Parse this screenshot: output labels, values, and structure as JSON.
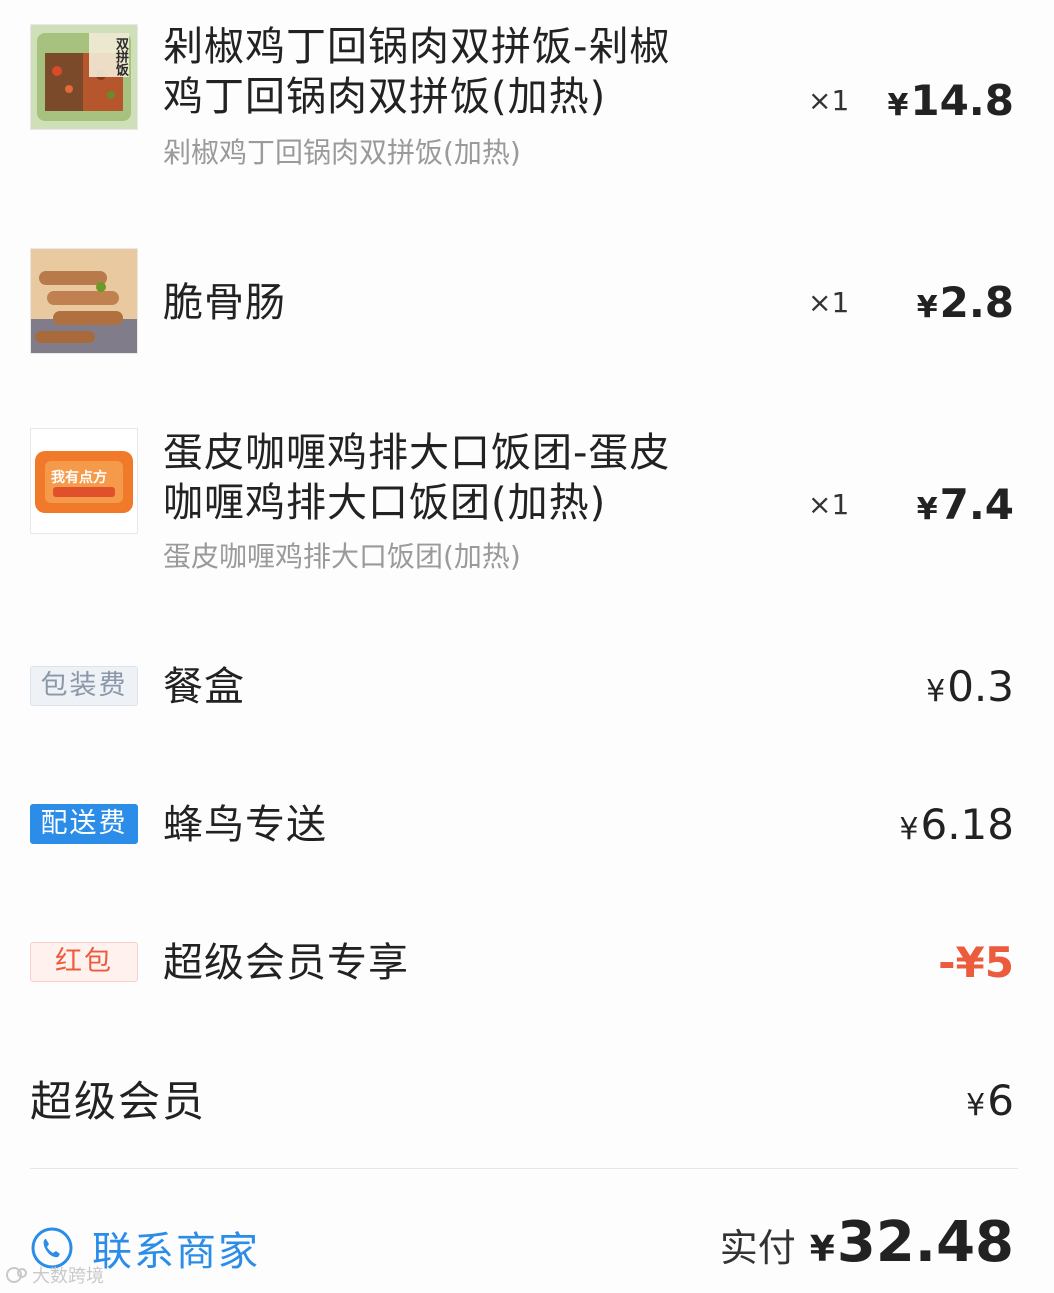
{
  "items": [
    {
      "name": "剁椒鸡丁回锅肉双拼饭-剁椒鸡丁回锅肉双拼饭(加热)",
      "spec": "剁椒鸡丁回锅肉双拼饭(加热)",
      "qty": "×1",
      "price": "14.8",
      "thumb_text": "双拼饭",
      "icon": "rice-box-thumbnail"
    },
    {
      "name": "脆骨肠",
      "spec": "",
      "qty": "×1",
      "price": "2.8",
      "icon": "sausage-thumbnail"
    },
    {
      "name": "蛋皮咖喱鸡排大口饭团-蛋皮咖喱鸡排大口饭团(加热)",
      "spec": "蛋皮咖喱鸡排大口饭团(加热)",
      "qty": "×1",
      "price": "7.4",
      "thumb_text": "我有点方",
      "icon": "rice-ball-package-thumbnail"
    }
  ],
  "currency": "¥",
  "fees": {
    "packaging": {
      "tag": "包装费",
      "label": "餐盒",
      "price": "0.3"
    },
    "delivery": {
      "tag": "配送费",
      "label": "蜂鸟专送",
      "price": "6.18"
    },
    "redpacket": {
      "tag": "红包",
      "label": "超级会员专享",
      "price": "-¥5"
    }
  },
  "super_member": {
    "label": "超级会员",
    "price": "6"
  },
  "footer": {
    "contact_label": "联系商家",
    "contact_icon": "phone-icon",
    "total_label": "实付",
    "total_value": "32.48"
  },
  "watermark": "大数跨境",
  "colors": {
    "accent_blue": "#2b8de8",
    "discount_red": "#ec5b3c",
    "muted_gray": "#9a9a9a"
  }
}
